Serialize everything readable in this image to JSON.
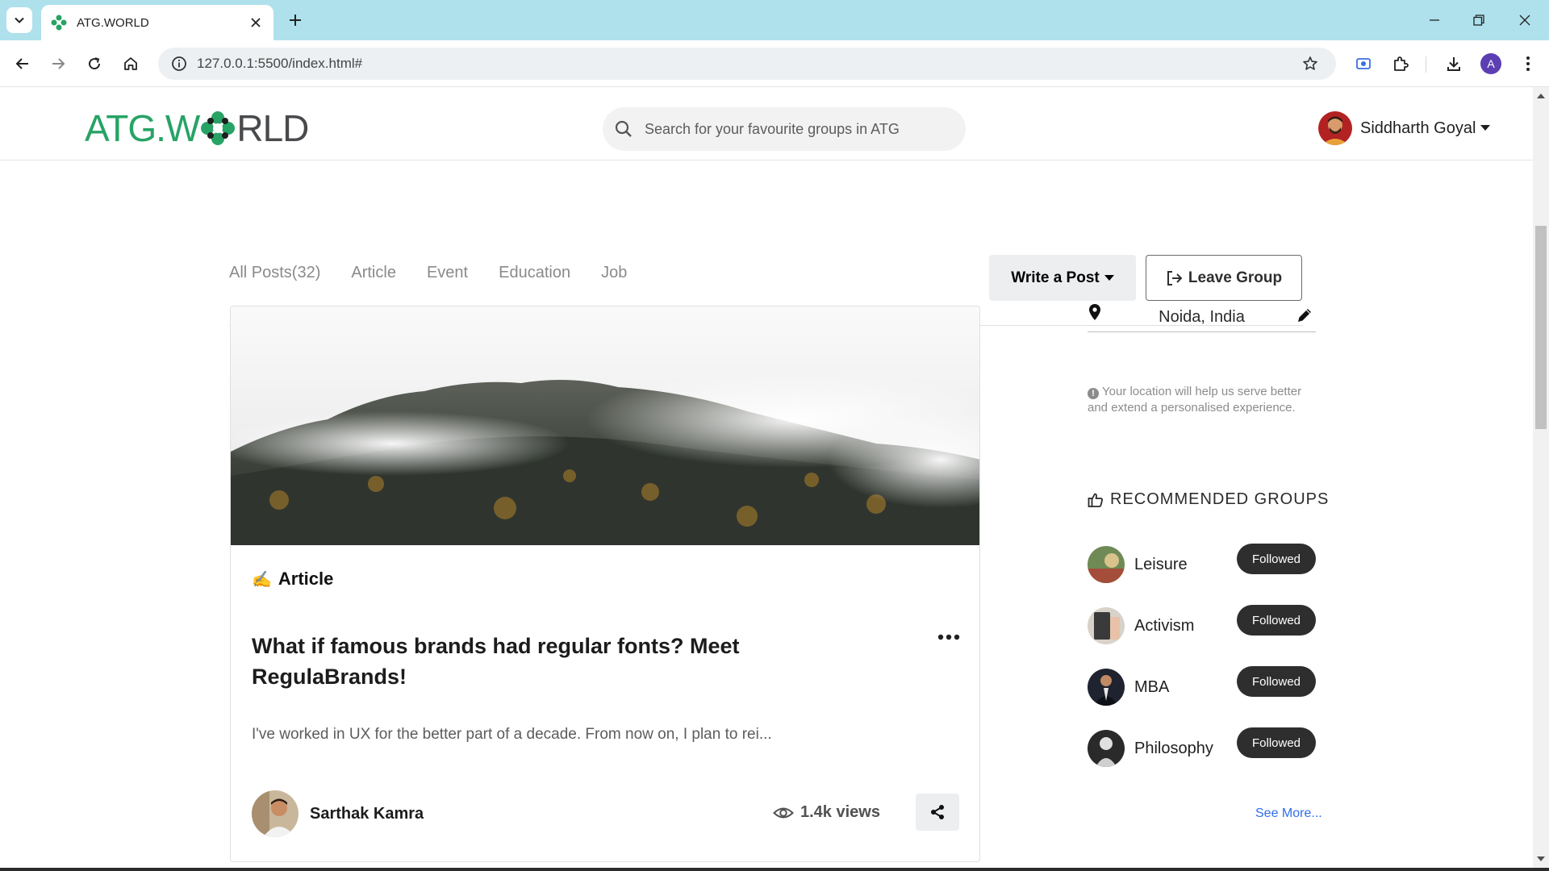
{
  "browser": {
    "tab_title": "ATG.WORLD",
    "url": "127.0.0.1:5500/index.html#",
    "profile_initial": "A"
  },
  "header": {
    "logo_left": "ATG.W",
    "logo_right": "RLD",
    "search_placeholder": "Search for your favourite groups in ATG",
    "user_name": "Siddharth Goyal"
  },
  "filters": {
    "tabs": [
      "All Posts(32)",
      "Article",
      "Event",
      "Education",
      "Job"
    ],
    "write_post_label": "Write a Post",
    "leave_group_label": "Leave Group"
  },
  "post": {
    "type_emoji": "✍️",
    "type_label": "Article",
    "title": "What if famous brands had regular fonts? Meet RegulaBrands!",
    "excerpt": "I've worked in UX for the better part of a decade. From now on, I plan to rei...",
    "author_name": "Sarthak Kamra",
    "views": "1.4k views"
  },
  "sidebar": {
    "location": "Noida, India",
    "location_hint": "Your location will help us serve better and extend a personalised experience.",
    "recommended_title": "RECOMMENDED GROUPS",
    "groups": [
      {
        "name": "Leisure",
        "button": "Followed"
      },
      {
        "name": "Activism",
        "button": "Followed"
      },
      {
        "name": "MBA",
        "button": "Followed"
      },
      {
        "name": "Philosophy",
        "button": "Followed"
      }
    ],
    "see_more": "See More..."
  },
  "colors": {
    "brand_green": "#27a365",
    "tabbar_bg": "#aee1ec",
    "followed_bg": "#2e2e2e",
    "link_blue": "#2f6fed"
  }
}
